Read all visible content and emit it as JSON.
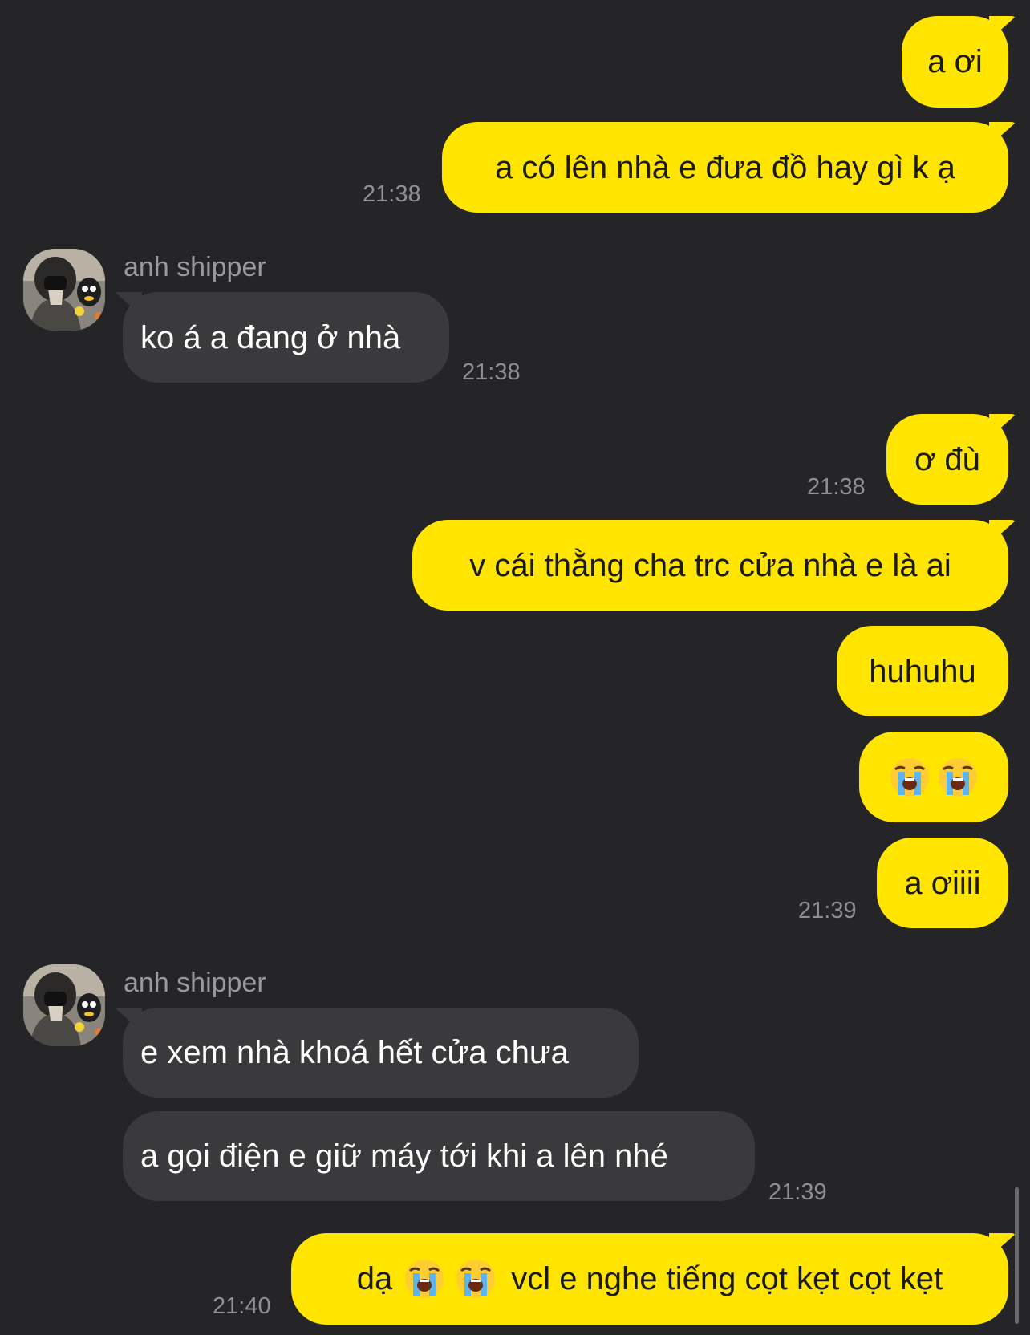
{
  "contact_name": "anh shipper",
  "messages": [
    {
      "text": "a ơi"
    },
    {
      "text": "a có lên nhà e đưa đồ hay gì k ạ",
      "time": "21:38"
    },
    {
      "text": "ko á a đang ở nhà",
      "time": "21:38"
    },
    {
      "text": "ơ đù",
      "time": "21:38"
    },
    {
      "text": "v cái thằng cha trc cửa nhà e là ai"
    },
    {
      "text": "huhuhu"
    },
    {
      "emoji": "loudly-crying-face",
      "count": 2
    },
    {
      "text": "a ơiiii",
      "time": "21:39"
    },
    {
      "text": "e xem nhà khoá hết cửa chưa"
    },
    {
      "text": "a gọi điện e giữ máy tới khi a lên nhé",
      "time": "21:39"
    },
    {
      "text_before": "dạ",
      "text_after": "vcl e nghe tiếng cọt kẹt cọt kẹt",
      "time": "21:40"
    }
  ],
  "colors": {
    "background": "#252527",
    "sent_bubble": "#ffe500",
    "received_bubble": "#3a3a3c",
    "timestamp": "#8e8e93"
  }
}
